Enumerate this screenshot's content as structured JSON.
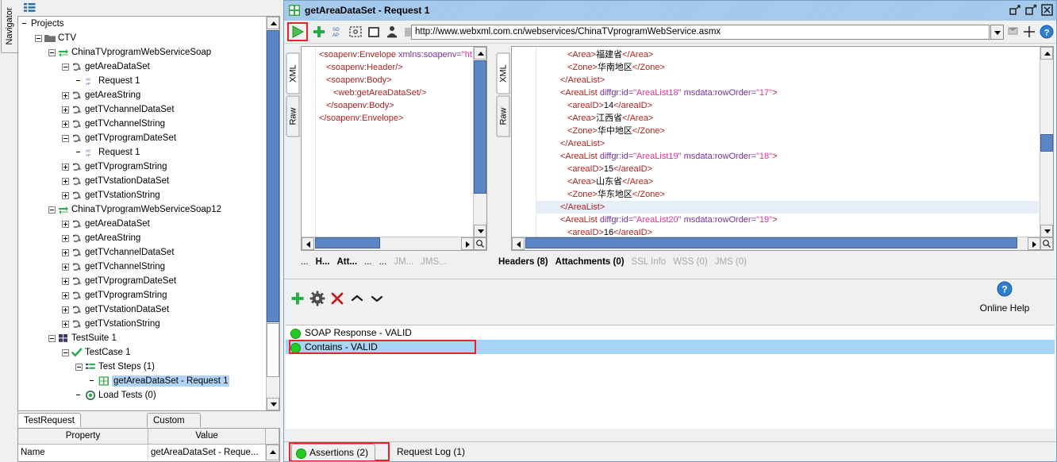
{
  "navigator": {
    "vertical_tab": "Navigator",
    "menu_icon": "menu-icon",
    "root_label": "Projects",
    "tree": [
      {
        "label": "Projects",
        "indent": 0,
        "expander": "none",
        "icon": "none",
        "selected": false
      },
      {
        "label": "CTV",
        "indent": 1,
        "expander": "minus",
        "icon": "folder-icon",
        "selected": false
      },
      {
        "label": "ChinaTVprogramWebServiceSoap",
        "indent": 2,
        "expander": "minus",
        "icon": "interface-icon",
        "selected": false
      },
      {
        "label": "getAreaDataSet",
        "indent": 3,
        "expander": "minus",
        "icon": "operation-icon",
        "selected": false
      },
      {
        "label": "Request 1",
        "indent": 4,
        "expander": "none",
        "icon": "soap-request-icon",
        "selected": false
      },
      {
        "label": "getAreaString",
        "indent": 3,
        "expander": "plus",
        "icon": "operation-icon",
        "selected": false
      },
      {
        "label": "getTVchannelDataSet",
        "indent": 3,
        "expander": "plus",
        "icon": "operation-icon",
        "selected": false
      },
      {
        "label": "getTVchannelString",
        "indent": 3,
        "expander": "plus",
        "icon": "operation-icon",
        "selected": false
      },
      {
        "label": "getTVprogramDateSet",
        "indent": 3,
        "expander": "minus",
        "icon": "operation-icon",
        "selected": false
      },
      {
        "label": "Request 1",
        "indent": 4,
        "expander": "none",
        "icon": "soap-request-icon",
        "selected": false
      },
      {
        "label": "getTVprogramString",
        "indent": 3,
        "expander": "plus",
        "icon": "operation-icon",
        "selected": false
      },
      {
        "label": "getTVstationDataSet",
        "indent": 3,
        "expander": "plus",
        "icon": "operation-icon",
        "selected": false
      },
      {
        "label": "getTVstationString",
        "indent": 3,
        "expander": "plus",
        "icon": "operation-icon",
        "selected": false
      },
      {
        "label": "ChinaTVprogramWebServiceSoap12",
        "indent": 2,
        "expander": "minus",
        "icon": "interface-icon",
        "selected": false
      },
      {
        "label": "getAreaDataSet",
        "indent": 3,
        "expander": "plus",
        "icon": "operation-icon",
        "selected": false
      },
      {
        "label": "getAreaString",
        "indent": 3,
        "expander": "plus",
        "icon": "operation-icon",
        "selected": false
      },
      {
        "label": "getTVchannelDataSet",
        "indent": 3,
        "expander": "plus",
        "icon": "operation-icon",
        "selected": false
      },
      {
        "label": "getTVchannelString",
        "indent": 3,
        "expander": "plus",
        "icon": "operation-icon",
        "selected": false
      },
      {
        "label": "getTVprogramDateSet",
        "indent": 3,
        "expander": "plus",
        "icon": "operation-icon",
        "selected": false
      },
      {
        "label": "getTVprogramString",
        "indent": 3,
        "expander": "plus",
        "icon": "operation-icon",
        "selected": false
      },
      {
        "label": "getTVstationDataSet",
        "indent": 3,
        "expander": "plus",
        "icon": "operation-icon",
        "selected": false
      },
      {
        "label": "getTVstationString",
        "indent": 3,
        "expander": "plus",
        "icon": "operation-icon",
        "selected": false
      },
      {
        "label": "TestSuite 1",
        "indent": 2,
        "expander": "minus",
        "icon": "testsuite-icon",
        "selected": false
      },
      {
        "label": "TestCase 1",
        "indent": 3,
        "expander": "minus",
        "icon": "testcase-icon",
        "selected": false
      },
      {
        "label": "Test Steps (1)",
        "indent": 4,
        "expander": "minus",
        "icon": "teststeps-icon",
        "selected": false
      },
      {
        "label": "getAreaDataSet - Request 1",
        "indent": 5,
        "expander": "none",
        "icon": "teststep-icon",
        "selected": true
      },
      {
        "label": "Load Tests (0)",
        "indent": 4,
        "expander": "none",
        "icon": "loadtests-icon",
        "selected": false
      }
    ]
  },
  "properties": {
    "tabs": [
      {
        "label": "TestRequest Properties",
        "active": true
      },
      {
        "label": "Custom Properties",
        "active": false
      }
    ],
    "columns": [
      "Property",
      "Value"
    ],
    "rows": [
      {
        "property": "Name",
        "value": "getAreaDataSet - Reque..."
      }
    ]
  },
  "window": {
    "title": "getAreaDataSet - Request 1",
    "title_icon": "request-window-icon",
    "buttons": [
      {
        "name": "minimize-button",
        "glyph": "restore-down-icon"
      },
      {
        "name": "maximize-button",
        "glyph": "maximize-icon"
      },
      {
        "name": "close-button",
        "glyph": "close-icon"
      }
    ]
  },
  "request_toolbar": {
    "icons": [
      {
        "name": "run-button",
        "glyph": "play-icon",
        "highlighted": true
      },
      {
        "name": "add-assertion-button",
        "glyph": "plus-icon"
      },
      {
        "name": "soap-raw-button",
        "glyph": "soap-icon"
      },
      {
        "name": "create-mock-button",
        "glyph": "dashed-square-icon"
      },
      {
        "name": "clear-button",
        "glyph": "square-icon"
      },
      {
        "name": "auth-button",
        "glyph": "person-icon"
      },
      {
        "name": "disabled-button",
        "glyph": "gray-square-icon"
      }
    ],
    "url": "http://www.webxml.com.cn/webservices/ChinaTVprogramWebService.asmx",
    "url_dropdown": "chevron-down-icon",
    "right_icons": [
      {
        "name": "endpoint-config-button",
        "glyph": "endpoint-icon"
      },
      {
        "name": "add-endpoint-button",
        "glyph": "plus-thin-icon"
      },
      {
        "name": "help-button",
        "glyph": "help-circle-icon"
      }
    ]
  },
  "request_editor": {
    "vertical_tabs": [
      {
        "label": "XML",
        "active": true
      },
      {
        "label": "Raw",
        "active": false
      }
    ],
    "lines": [
      {
        "indent": 0,
        "fold": true,
        "parts": [
          {
            "t": "tag",
            "v": "<soapenv:Envelope "
          },
          {
            "t": "attr",
            "v": "xmlns:soapenv="
          },
          {
            "t": "val",
            "v": "\"http"
          }
        ]
      },
      {
        "indent": 1,
        "fold": false,
        "parts": [
          {
            "t": "tag",
            "v": "<soapenv:Header/>"
          }
        ]
      },
      {
        "indent": 1,
        "fold": true,
        "parts": [
          {
            "t": "tag",
            "v": "<soapenv:Body>"
          }
        ]
      },
      {
        "indent": 2,
        "fold": false,
        "parts": [
          {
            "t": "tag",
            "v": "<web:getAreaDataSet/>"
          }
        ]
      },
      {
        "indent": 1,
        "fold": false,
        "parts": [
          {
            "t": "tag",
            "v": "</soapenv:Body>"
          }
        ]
      },
      {
        "indent": 0,
        "fold": false,
        "parts": [
          {
            "t": "tag",
            "v": "</soapenv:Envelope>"
          }
        ]
      }
    ],
    "tabs": [
      {
        "label": "...",
        "dim": false,
        "bold": false
      },
      {
        "label": "H...",
        "dim": false,
        "bold": true
      },
      {
        "label": "Att...",
        "dim": false,
        "bold": true
      },
      {
        "label": "...",
        "dim": false,
        "bold": false
      },
      {
        "label": "...",
        "dim": false,
        "bold": false
      },
      {
        "label": "JM...",
        "dim": true,
        "bold": false
      },
      {
        "label": "JMS...",
        "dim": true,
        "bold": false
      }
    ]
  },
  "response_editor": {
    "vertical_tabs": [
      {
        "label": "XML",
        "active": true
      },
      {
        "label": "Raw",
        "active": false
      }
    ],
    "lines": [
      {
        "indent": 4,
        "fold": false,
        "hl": false,
        "parts": [
          {
            "t": "tag",
            "v": "<Area>"
          },
          {
            "t": "txt",
            "v": "福建省"
          },
          {
            "t": "tag",
            "v": "</Area>"
          }
        ]
      },
      {
        "indent": 4,
        "fold": false,
        "hl": false,
        "parts": [
          {
            "t": "tag",
            "v": "<Zone>"
          },
          {
            "t": "txt",
            "v": "华南地区"
          },
          {
            "t": "tag",
            "v": "</Zone>"
          }
        ]
      },
      {
        "indent": 3,
        "fold": false,
        "hl": false,
        "parts": [
          {
            "t": "tag",
            "v": "</AreaList>"
          }
        ]
      },
      {
        "indent": 3,
        "fold": true,
        "hl": false,
        "parts": [
          {
            "t": "tag",
            "v": "<AreaList "
          },
          {
            "t": "attr",
            "v": "diffgr:id="
          },
          {
            "t": "val",
            "v": "\"AreaList18\""
          },
          {
            "t": "attr",
            "v": " msdata:rowOrder="
          },
          {
            "t": "val",
            "v": "\"17\""
          },
          {
            "t": "tag",
            "v": ">"
          }
        ]
      },
      {
        "indent": 4,
        "fold": false,
        "hl": false,
        "parts": [
          {
            "t": "tag",
            "v": "<areaID>"
          },
          {
            "t": "txt",
            "v": "14"
          },
          {
            "t": "tag",
            "v": "</areaID>"
          }
        ]
      },
      {
        "indent": 4,
        "fold": false,
        "hl": false,
        "parts": [
          {
            "t": "tag",
            "v": "<Area>"
          },
          {
            "t": "txt",
            "v": "江西省"
          },
          {
            "t": "tag",
            "v": "</Area>"
          }
        ]
      },
      {
        "indent": 4,
        "fold": false,
        "hl": false,
        "parts": [
          {
            "t": "tag",
            "v": "<Zone>"
          },
          {
            "t": "txt",
            "v": "华中地区"
          },
          {
            "t": "tag",
            "v": "</Zone>"
          }
        ]
      },
      {
        "indent": 3,
        "fold": false,
        "hl": false,
        "parts": [
          {
            "t": "tag",
            "v": "</AreaList>"
          }
        ]
      },
      {
        "indent": 3,
        "fold": true,
        "hl": false,
        "parts": [
          {
            "t": "tag",
            "v": "<AreaList "
          },
          {
            "t": "attr",
            "v": "diffgr:id="
          },
          {
            "t": "val",
            "v": "\"AreaList19\""
          },
          {
            "t": "attr",
            "v": " msdata:rowOrder="
          },
          {
            "t": "val",
            "v": "\"18\""
          },
          {
            "t": "tag",
            "v": ">"
          }
        ]
      },
      {
        "indent": 4,
        "fold": false,
        "hl": false,
        "parts": [
          {
            "t": "tag",
            "v": "<areaID>"
          },
          {
            "t": "txt",
            "v": "15"
          },
          {
            "t": "tag",
            "v": "</areaID>"
          }
        ]
      },
      {
        "indent": 4,
        "fold": false,
        "hl": false,
        "parts": [
          {
            "t": "tag",
            "v": "<Area>"
          },
          {
            "t": "txt",
            "v": "山东省"
          },
          {
            "t": "tag",
            "v": "</Area>"
          }
        ]
      },
      {
        "indent": 4,
        "fold": false,
        "hl": false,
        "parts": [
          {
            "t": "tag",
            "v": "<Zone>"
          },
          {
            "t": "txt",
            "v": "华东地区"
          },
          {
            "t": "tag",
            "v": "</Zone>"
          }
        ]
      },
      {
        "indent": 3,
        "fold": false,
        "hl": true,
        "parts": [
          {
            "t": "tag",
            "v": "</AreaList>"
          }
        ]
      },
      {
        "indent": 3,
        "fold": true,
        "hl": false,
        "parts": [
          {
            "t": "tag",
            "v": "<AreaList "
          },
          {
            "t": "attr",
            "v": "diffgr:id="
          },
          {
            "t": "val",
            "v": "\"AreaList20\""
          },
          {
            "t": "attr",
            "v": " msdata:rowOrder="
          },
          {
            "t": "val",
            "v": "\"19\""
          },
          {
            "t": "tag",
            "v": ">"
          }
        ]
      },
      {
        "indent": 4,
        "fold": false,
        "hl": false,
        "parts": [
          {
            "t": "tag",
            "v": "<areaID>"
          },
          {
            "t": "txt",
            "v": "16"
          },
          {
            "t": "tag",
            "v": "</areaID>"
          }
        ]
      }
    ],
    "tabs": [
      {
        "label": "Headers (8)",
        "dim": false,
        "bold": true
      },
      {
        "label": "Attachments (0)",
        "dim": false,
        "bold": true
      },
      {
        "label": "SSL Info",
        "dim": true,
        "bold": false
      },
      {
        "label": "WSS (0)",
        "dim": true,
        "bold": false
      },
      {
        "label": "JMS (0)",
        "dim": true,
        "bold": false
      }
    ]
  },
  "assertions": {
    "toolbar": [
      {
        "name": "add-assertion-button",
        "glyph": "plus-icon",
        "color": "#2cab4b"
      },
      {
        "name": "configure-assertion-button",
        "glyph": "gear-icon",
        "color": "#4d4d4d"
      },
      {
        "name": "remove-assertion-button",
        "glyph": "x-icon",
        "color": "#c02020"
      },
      {
        "name": "move-up-button",
        "glyph": "chevron-up-icon",
        "color": "#202020"
      },
      {
        "name": "move-down-button",
        "glyph": "chevron-down-icon",
        "color": "#202020"
      }
    ],
    "help": {
      "icon": "help-circle-icon",
      "label": "Online Help"
    },
    "rows": [
      {
        "label": "SOAP Response - VALID",
        "status_color": "#22cc22",
        "selected": false,
        "highlighted": false
      },
      {
        "label": "Contains - VALID",
        "status_color": "#22cc22",
        "selected": true,
        "highlighted": true
      }
    ]
  },
  "bottom_tabs": [
    {
      "label": "Assertions (2)",
      "active": true,
      "bullet_color": "#22cc22",
      "highlighted": true
    },
    {
      "label": "Request Log (1)",
      "active": false,
      "bullet_color": null,
      "highlighted": false
    }
  ],
  "colors": {
    "selection_blue": "#b0d4f7",
    "highlight_red": "#e8242a",
    "title_blue": "#9cc3e8",
    "scrollbar_blue": "#5b86c6"
  }
}
